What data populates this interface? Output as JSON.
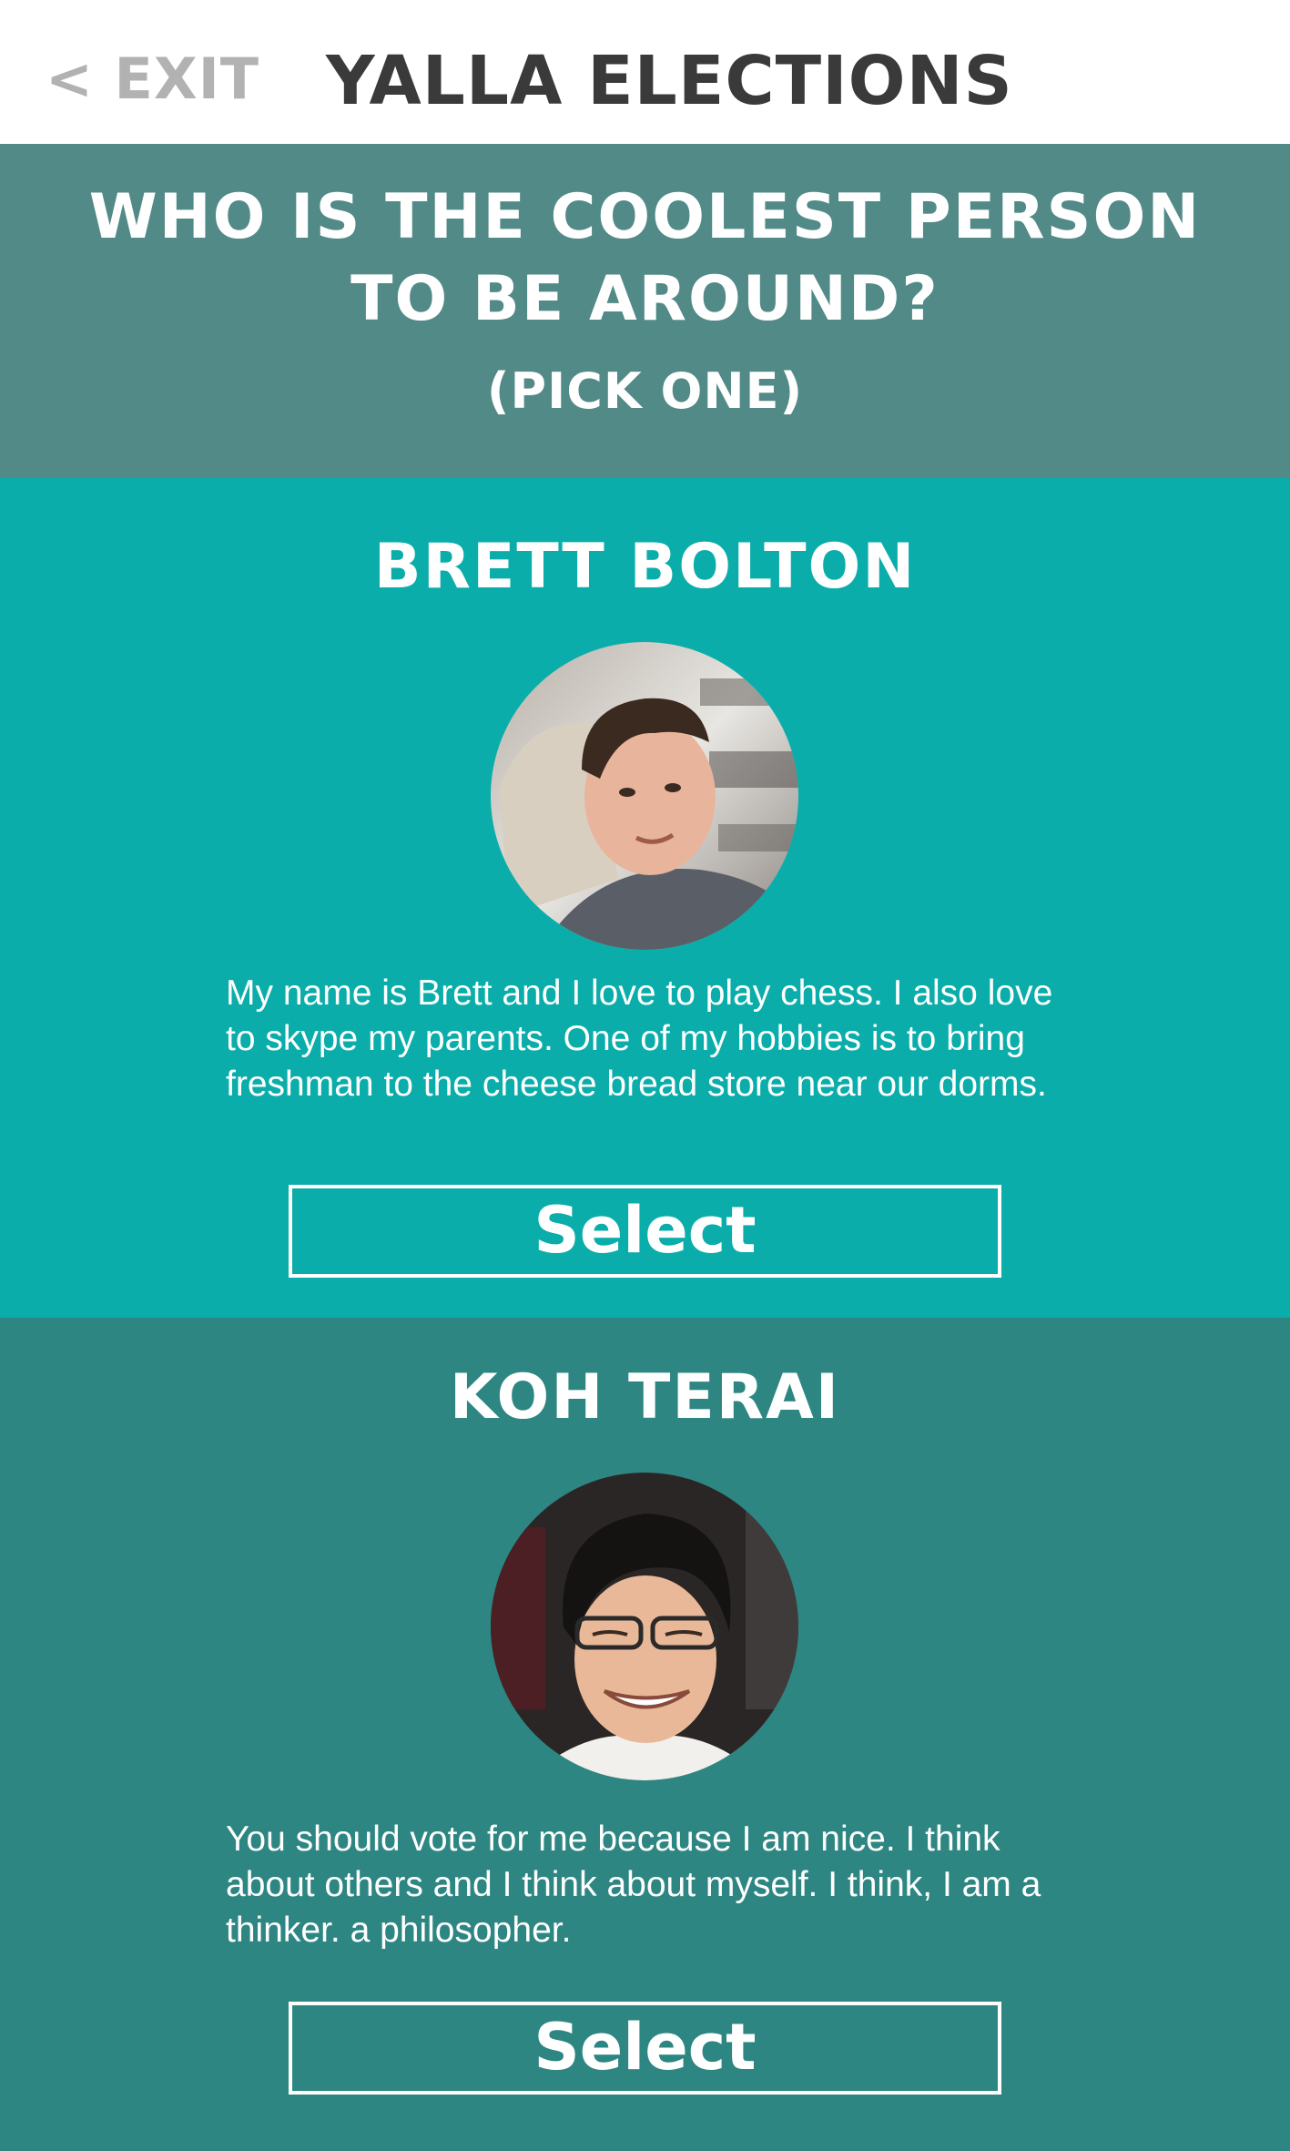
{
  "header": {
    "exit_label": "< EXIT",
    "title": "YALLA ELECTIONS"
  },
  "question": {
    "title": "WHO IS THE COOLEST PERSON TO BE AROUND?",
    "subtitle": "(PICK ONE)"
  },
  "candidates": [
    {
      "name": "BRETT BOLTON",
      "bio": "My name is Brett and I love to play chess.  I also love to skype my parents.  One of my hobbies is to bring freshman to the cheese bread store near our dorms.",
      "select_label": "Select",
      "photo_icon": "avatar-photo-brett"
    },
    {
      "name": "KOH TERAI",
      "bio": "You should vote for me because I am nice.  I think about others and I think about myself.  I think, I am a thinker. a philosopher.",
      "select_label": "Select",
      "photo_icon": "avatar-photo-koh"
    }
  ],
  "colors": {
    "question_bg": "#528a87",
    "candidate_1_bg": "#0badaa",
    "candidate_2_bg": "#2e8683",
    "exit_color": "#b2b2b2",
    "title_color": "#3a3a3a"
  }
}
